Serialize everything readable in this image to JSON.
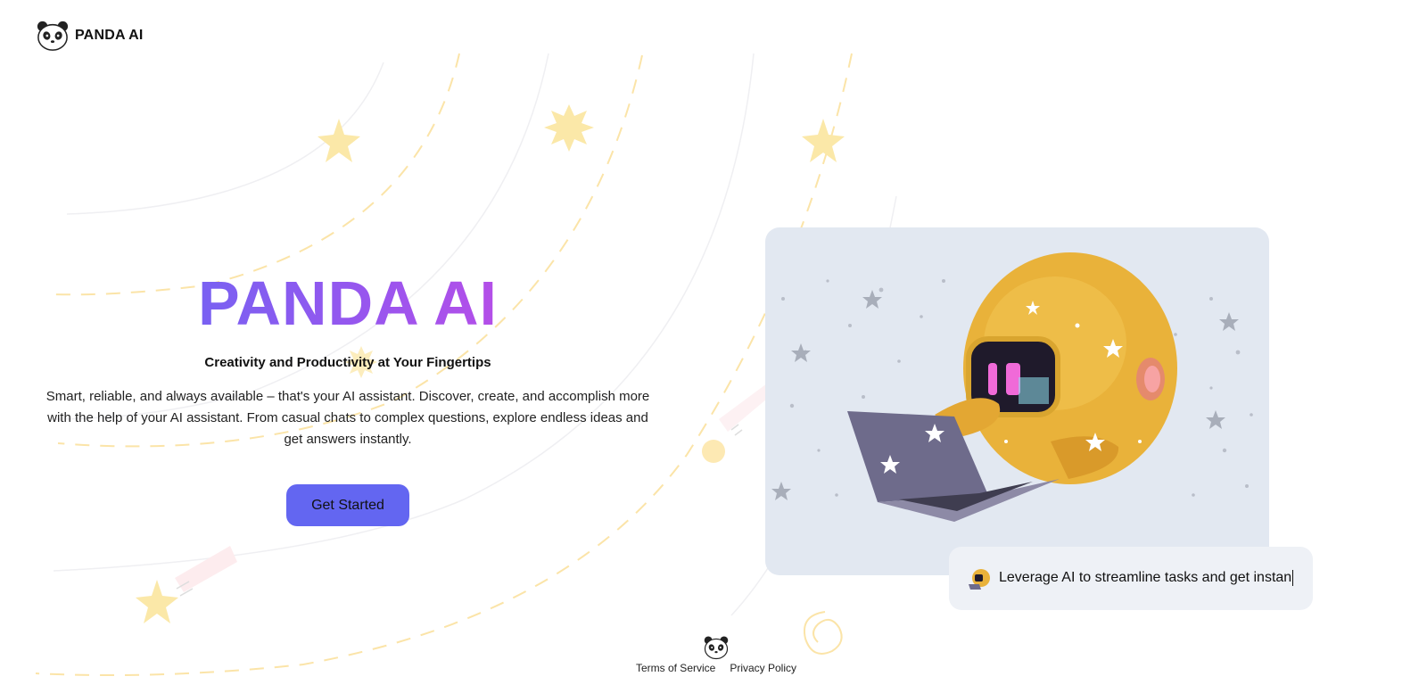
{
  "header": {
    "logo_icon": "panda-icon",
    "brand_name": "PANDA AI"
  },
  "hero": {
    "title": "PANDA AI",
    "subtitle": "Creativity and Productivity at Your Fingertips",
    "description": "Smart, reliable, and always available – that's your AI assistant. Discover, create, and accomplish more with the help of your AI assistant. From casual chats to complex questions, explore endless ideas and get answers instantly.",
    "cta_label": "Get Started"
  },
  "illustration": {
    "subject": "robot-with-laptop-illustration",
    "background_color": "#e2e8f1"
  },
  "chat_bubble": {
    "avatar_icon": "robot-avatar-icon",
    "text": "Leverage AI to streamline tasks and get instan"
  },
  "footer": {
    "logo_icon": "panda-icon",
    "links": [
      {
        "label": "Terms of Service"
      },
      {
        "label": "Privacy Policy"
      }
    ]
  },
  "colors": {
    "accent": "#6366f1",
    "gradient_start": "#5b6cf5",
    "gradient_end": "#d946e0",
    "decor_yellow": "#fde9a8"
  }
}
